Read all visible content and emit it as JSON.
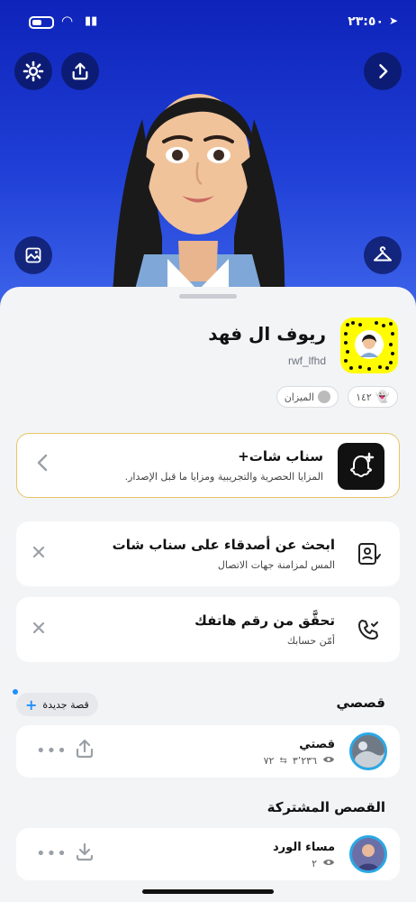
{
  "status_bar": {
    "time": "٢٣:٥٠"
  },
  "profile": {
    "display_name": "ريوف ال فهد",
    "username": "rwf_lfhd",
    "friends_count": "١٤٢",
    "zodiac": "الميزان"
  },
  "snapchat_plus": {
    "title": "سناب شات+",
    "subtitle": "المزايا الحصرية والتجريبية ومزايا ما قبل الإصدار."
  },
  "suggestions": [
    {
      "title": "ابحث عن أصدقاء على سناب شات",
      "subtitle": "المس لمزامنة جهات الاتصال"
    },
    {
      "title": "تحقَّق من رقم هاتفك",
      "subtitle": "أمّن حسابك"
    }
  ],
  "my_stories": {
    "section_title": "قصصي",
    "new_story_label": "قصة جديدة",
    "item": {
      "title": "قصتي",
      "views": "٣٬٢٣٦",
      "screenshots": "٧٢"
    }
  },
  "shared_stories": {
    "section_title": "القصص المشتركة",
    "item": {
      "title": "مساء الورد",
      "views": "٢"
    }
  },
  "colors": {
    "accent_blue": "#1f3fd6",
    "snap_yellow": "#fffc00",
    "plus_border": "#e6c567",
    "story_ring": "#2aa8e6"
  },
  "icons": [
    "settings-icon",
    "share-icon",
    "back-chevron-icon",
    "image-icon",
    "hanger-icon",
    "ghost-icon",
    "zodiac-icon",
    "snap-plus-icon",
    "contacts-icon",
    "phone-icon",
    "close-icon",
    "eye-icon",
    "upload-icon",
    "download-icon",
    "more-icon"
  ]
}
